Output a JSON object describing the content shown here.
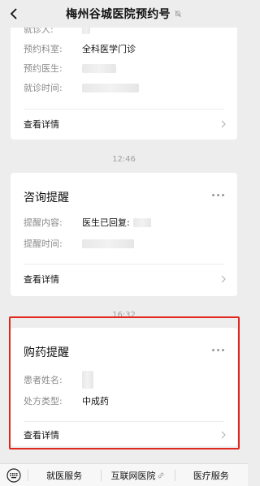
{
  "header": {
    "title": "梅州谷城医院预约号"
  },
  "card1": {
    "rows": [
      {
        "label": "就诊人:",
        "value": ""
      },
      {
        "label": "预约科室:",
        "value": "全科医学门诊"
      },
      {
        "label": "预约医生:",
        "value": ""
      },
      {
        "label": "就诊时间:",
        "value": ""
      }
    ],
    "detail_label": "查看详情"
  },
  "time1": "12:46",
  "card2": {
    "title": "咨询提醒",
    "rows": [
      {
        "label": "提醒内容:",
        "value": "医生已回复:"
      },
      {
        "label": "提醒时间:",
        "value": ""
      }
    ],
    "detail_label": "查看详情"
  },
  "time2": "16:32",
  "card3": {
    "title": "购药提醒",
    "rows": [
      {
        "label": "患者姓名:",
        "value": ""
      },
      {
        "label": "处方类型:",
        "value": "中成药"
      }
    ],
    "detail_label": "查看详情"
  },
  "menu": {
    "items": [
      {
        "label": "就医服务"
      },
      {
        "label": "互联网医院"
      },
      {
        "label": "医疗服务"
      }
    ]
  },
  "colors": {
    "highlight": "#e0281e",
    "background": "#ededed"
  }
}
